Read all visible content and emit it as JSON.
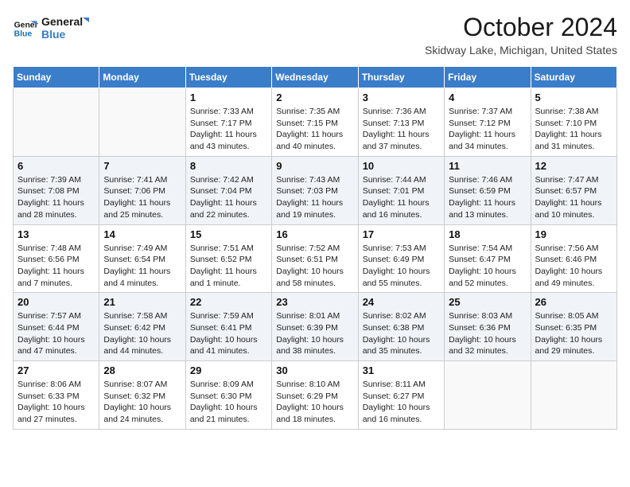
{
  "header": {
    "logo_line1": "General",
    "logo_line2": "Blue",
    "title": "October 2024",
    "location": "Skidway Lake, Michigan, United States"
  },
  "days_of_week": [
    "Sunday",
    "Monday",
    "Tuesday",
    "Wednesday",
    "Thursday",
    "Friday",
    "Saturday"
  ],
  "weeks": [
    [
      {
        "day": "",
        "info": ""
      },
      {
        "day": "",
        "info": ""
      },
      {
        "day": "1",
        "info": "Sunrise: 7:33 AM\nSunset: 7:17 PM\nDaylight: 11 hours and 43 minutes."
      },
      {
        "day": "2",
        "info": "Sunrise: 7:35 AM\nSunset: 7:15 PM\nDaylight: 11 hours and 40 minutes."
      },
      {
        "day": "3",
        "info": "Sunrise: 7:36 AM\nSunset: 7:13 PM\nDaylight: 11 hours and 37 minutes."
      },
      {
        "day": "4",
        "info": "Sunrise: 7:37 AM\nSunset: 7:12 PM\nDaylight: 11 hours and 34 minutes."
      },
      {
        "day": "5",
        "info": "Sunrise: 7:38 AM\nSunset: 7:10 PM\nDaylight: 11 hours and 31 minutes."
      }
    ],
    [
      {
        "day": "6",
        "info": "Sunrise: 7:39 AM\nSunset: 7:08 PM\nDaylight: 11 hours and 28 minutes."
      },
      {
        "day": "7",
        "info": "Sunrise: 7:41 AM\nSunset: 7:06 PM\nDaylight: 11 hours and 25 minutes."
      },
      {
        "day": "8",
        "info": "Sunrise: 7:42 AM\nSunset: 7:04 PM\nDaylight: 11 hours and 22 minutes."
      },
      {
        "day": "9",
        "info": "Sunrise: 7:43 AM\nSunset: 7:03 PM\nDaylight: 11 hours and 19 minutes."
      },
      {
        "day": "10",
        "info": "Sunrise: 7:44 AM\nSunset: 7:01 PM\nDaylight: 11 hours and 16 minutes."
      },
      {
        "day": "11",
        "info": "Sunrise: 7:46 AM\nSunset: 6:59 PM\nDaylight: 11 hours and 13 minutes."
      },
      {
        "day": "12",
        "info": "Sunrise: 7:47 AM\nSunset: 6:57 PM\nDaylight: 11 hours and 10 minutes."
      }
    ],
    [
      {
        "day": "13",
        "info": "Sunrise: 7:48 AM\nSunset: 6:56 PM\nDaylight: 11 hours and 7 minutes."
      },
      {
        "day": "14",
        "info": "Sunrise: 7:49 AM\nSunset: 6:54 PM\nDaylight: 11 hours and 4 minutes."
      },
      {
        "day": "15",
        "info": "Sunrise: 7:51 AM\nSunset: 6:52 PM\nDaylight: 11 hours and 1 minute."
      },
      {
        "day": "16",
        "info": "Sunrise: 7:52 AM\nSunset: 6:51 PM\nDaylight: 10 hours and 58 minutes."
      },
      {
        "day": "17",
        "info": "Sunrise: 7:53 AM\nSunset: 6:49 PM\nDaylight: 10 hours and 55 minutes."
      },
      {
        "day": "18",
        "info": "Sunrise: 7:54 AM\nSunset: 6:47 PM\nDaylight: 10 hours and 52 minutes."
      },
      {
        "day": "19",
        "info": "Sunrise: 7:56 AM\nSunset: 6:46 PM\nDaylight: 10 hours and 49 minutes."
      }
    ],
    [
      {
        "day": "20",
        "info": "Sunrise: 7:57 AM\nSunset: 6:44 PM\nDaylight: 10 hours and 47 minutes."
      },
      {
        "day": "21",
        "info": "Sunrise: 7:58 AM\nSunset: 6:42 PM\nDaylight: 10 hours and 44 minutes."
      },
      {
        "day": "22",
        "info": "Sunrise: 7:59 AM\nSunset: 6:41 PM\nDaylight: 10 hours and 41 minutes."
      },
      {
        "day": "23",
        "info": "Sunrise: 8:01 AM\nSunset: 6:39 PM\nDaylight: 10 hours and 38 minutes."
      },
      {
        "day": "24",
        "info": "Sunrise: 8:02 AM\nSunset: 6:38 PM\nDaylight: 10 hours and 35 minutes."
      },
      {
        "day": "25",
        "info": "Sunrise: 8:03 AM\nSunset: 6:36 PM\nDaylight: 10 hours and 32 minutes."
      },
      {
        "day": "26",
        "info": "Sunrise: 8:05 AM\nSunset: 6:35 PM\nDaylight: 10 hours and 29 minutes."
      }
    ],
    [
      {
        "day": "27",
        "info": "Sunrise: 8:06 AM\nSunset: 6:33 PM\nDaylight: 10 hours and 27 minutes."
      },
      {
        "day": "28",
        "info": "Sunrise: 8:07 AM\nSunset: 6:32 PM\nDaylight: 10 hours and 24 minutes."
      },
      {
        "day": "29",
        "info": "Sunrise: 8:09 AM\nSunset: 6:30 PM\nDaylight: 10 hours and 21 minutes."
      },
      {
        "day": "30",
        "info": "Sunrise: 8:10 AM\nSunset: 6:29 PM\nDaylight: 10 hours and 18 minutes."
      },
      {
        "day": "31",
        "info": "Sunrise: 8:11 AM\nSunset: 6:27 PM\nDaylight: 10 hours and 16 minutes."
      },
      {
        "day": "",
        "info": ""
      },
      {
        "day": "",
        "info": ""
      }
    ]
  ]
}
